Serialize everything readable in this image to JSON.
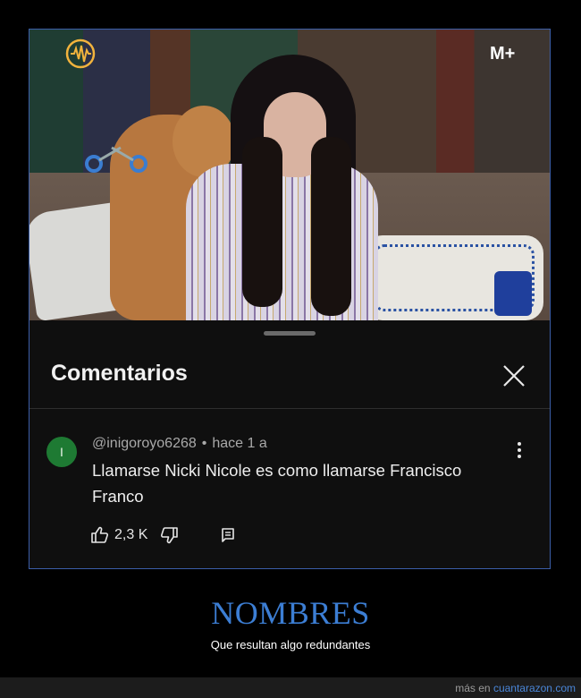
{
  "video": {
    "channel_logo_icon": "radio-wave-icon",
    "broadcaster_logo": "M+"
  },
  "panel": {
    "title": "Comentarios",
    "close_icon": "close-icon"
  },
  "comment": {
    "avatar_letter": "I",
    "avatar_color": "#1e7a33",
    "author": "@inigoroyo6268",
    "separator": "•",
    "time": "hace 1 a",
    "text": "Llamarse Nicki Nicole es como llamarse Francisco Franco",
    "likes": "2,3 K",
    "more_icon": "more-vertical-icon",
    "like_icon": "thumbs-up-icon",
    "dislike_icon": "thumbs-down-icon",
    "reply_icon": "reply-icon"
  },
  "caption": {
    "headline": "NOMBRES",
    "subline": "Que resultan algo redundantes",
    "headline_color": "#3c7ed4"
  },
  "footer": {
    "prefix": "más en",
    "site": "cuantarazon.com"
  }
}
